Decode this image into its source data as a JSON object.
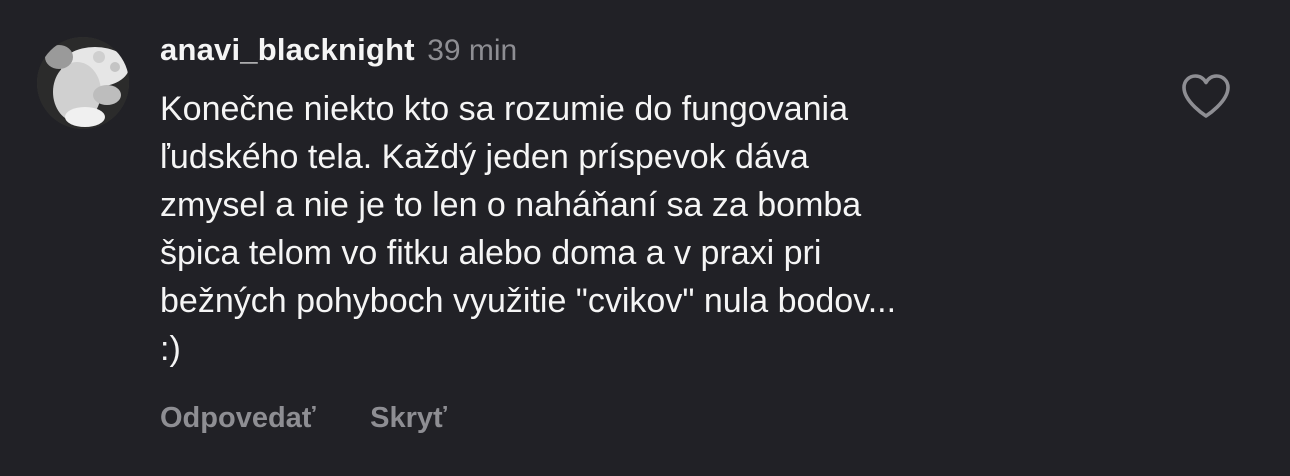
{
  "comment": {
    "username": "anavi_blacknight",
    "time": "39 min",
    "text_lines": [
      "Konečne niekto kto sa rozumie do fungovania",
      "ľudského tela. Každý jeden príspevok dáva",
      "zmysel a nie je to len o naháňaní sa za bomba",
      "špica telom vo fitku alebo doma a v praxi pri",
      "bežných pohyboch využitie \"cvikov\" nula bodov...",
      ":)"
    ],
    "like_icon": "heart-outline-icon",
    "actions": {
      "reply_label": "Odpovedať",
      "hide_label": "Skryť"
    }
  },
  "colors": {
    "background": "#212126",
    "primary_text": "#f5f5f5",
    "secondary_text": "#8e8e93"
  }
}
